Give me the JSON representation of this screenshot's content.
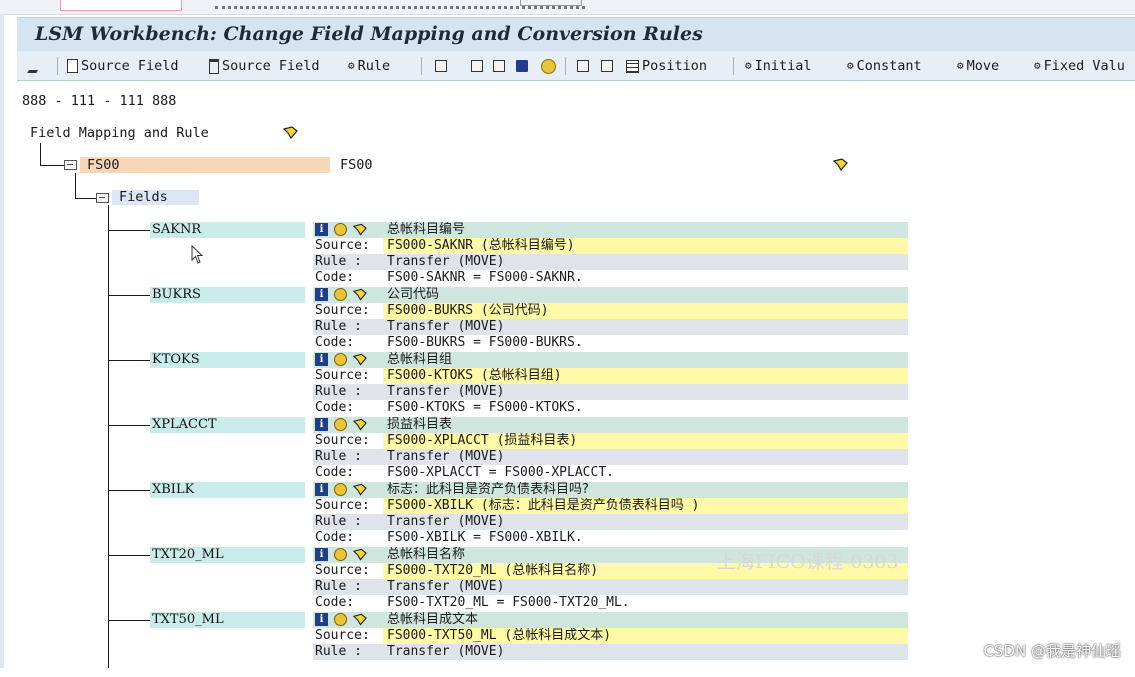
{
  "window": {
    "title": "LSM Workbench: Change Field Mapping and Conversion Rules"
  },
  "toolbar": {
    "items": [
      {
        "label": "Source Field",
        "icon": "document-icon"
      },
      {
        "label": "Source Field",
        "icon": "trash-icon"
      },
      {
        "label": "Rule",
        "icon": "rule-icon"
      },
      {
        "label": "Position",
        "icon": "grid-icon"
      },
      {
        "label": "Initial",
        "icon": "rule-icon"
      },
      {
        "label": "Constant",
        "icon": "rule-icon"
      },
      {
        "label": "Move",
        "icon": "rule-icon"
      },
      {
        "label": "Fixed Valu",
        "icon": "rule-icon"
      }
    ]
  },
  "mapping_id": "888 - 111 - 111 888",
  "tree": {
    "root_label": "Field Mapping and Rule",
    "object": {
      "name": "FS00",
      "description": "FS00"
    },
    "fields_label": "Fields",
    "fields": [
      {
        "name": "SAKNR",
        "desc": "总帐科目编号",
        "source_label": "Source:",
        "source": "FS000-SAKNR (总帐科目编号)",
        "rule_label": "Rule :",
        "rule": "Transfer (MOVE)",
        "code_label": "Code:",
        "code": "FS00-SAKNR = FS000-SAKNR."
      },
      {
        "name": "BUKRS",
        "desc": "公司代码",
        "source_label": "Source:",
        "source": "FS000-BUKRS (公司代码)",
        "rule_label": "Rule :",
        "rule": "Transfer (MOVE)",
        "code_label": "Code:",
        "code": "FS00-BUKRS = FS000-BUKRS."
      },
      {
        "name": "KTOKS",
        "desc": "总帐科目组",
        "source_label": "Source:",
        "source": "FS000-KTOKS (总帐科目组)",
        "rule_label": "Rule :",
        "rule": "Transfer (MOVE)",
        "code_label": "Code:",
        "code": "FS00-KTOKS = FS000-KTOKS."
      },
      {
        "name": "XPLACCT",
        "desc": "损益科目表",
        "source_label": "Source:",
        "source": "FS000-XPLACCT (损益科目表)",
        "rule_label": "Rule :",
        "rule": "Transfer (MOVE)",
        "code_label": "Code:",
        "code": "FS00-XPLACCT = FS000-XPLACCT."
      },
      {
        "name": "XBILK",
        "desc": "标志：此科目是资产负债表科目吗?",
        "source_label": "Source:",
        "source": "FS000-XBILK (标志：此科目是资产负债表科目吗 )",
        "rule_label": "Rule :",
        "rule": "Transfer (MOVE)",
        "code_label": "Code:",
        "code": "FS00-XBILK = FS000-XBILK."
      },
      {
        "name": "TXT20_ML",
        "desc": "总帐科目名称",
        "source_label": "Source:",
        "source": "FS000-TXT20_ML (总帐科目名称)",
        "rule_label": "Rule :",
        "rule": "Transfer (MOVE)",
        "code_label": "Code:",
        "code": "FS00-TXT20_ML = FS000-TXT20_ML."
      },
      {
        "name": "TXT50_ML",
        "desc": "总帐科目成文本",
        "source_label": "Source:",
        "source": "FS000-TXT50_ML (总帐科目成文本)",
        "rule_label": "Rule :",
        "rule": "Transfer (MOVE)",
        "code_label": "Code:",
        "code": ""
      }
    ]
  },
  "watermark": "上海FICO课程-0303",
  "csdn_watermark": "CSDN @我是神仙瑶"
}
